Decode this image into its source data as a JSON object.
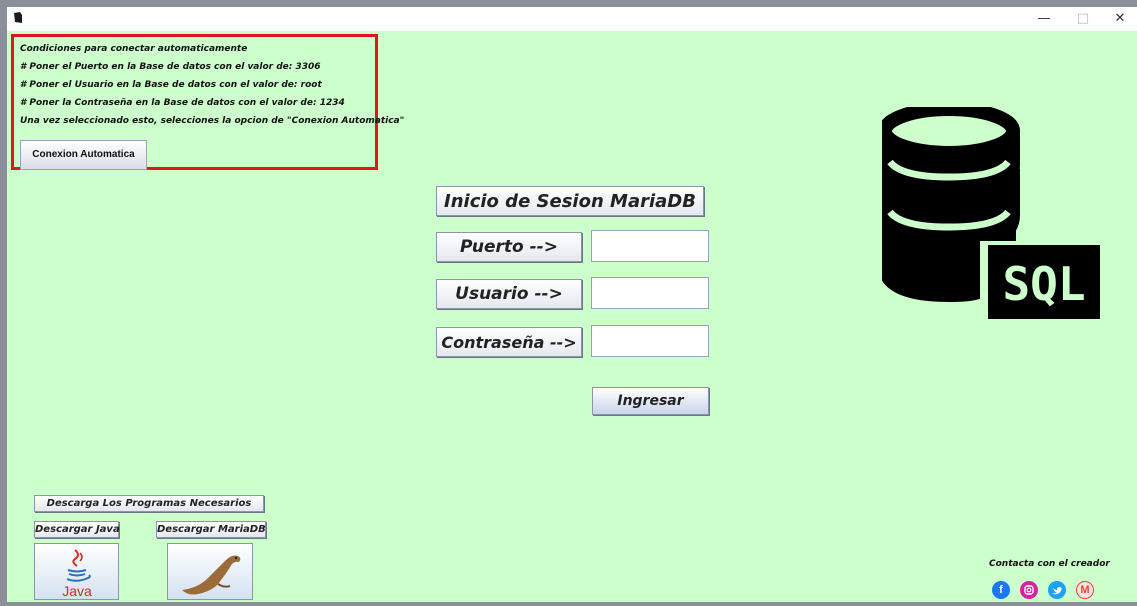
{
  "window": {
    "minimize_glyph": "—",
    "maximize_glyph": "□",
    "close_glyph": "✕"
  },
  "info": {
    "lines": [
      "Condiciones para conectar automaticamente",
      "# Poner el Puerto en la Base de datos con el valor de: 3306",
      "# Poner el Usuario en la Base de datos con el valor de: root",
      "# Poner la Contraseña en la Base de datos con el valor de: 1234",
      "Una vez seleccionado esto, selecciones la opcion de \"Conexion Automatica\""
    ],
    "auto_button": "Conexion Automatica",
    "border_color": "#e0161e"
  },
  "login": {
    "title": "Inicio de Sesion MariaDB",
    "port_label": "Puerto -->",
    "port_value": "",
    "user_label": "Usuario -->",
    "user_value": "",
    "password_label": "Contraseña -->",
    "password_value": "",
    "submit": "Ingresar"
  },
  "downloads": {
    "header": "Descarga Los Programas Necesarios",
    "java_label": "Descargar Java",
    "mariadb_label": "Descargar MariaDB",
    "java_logo_text": "Java"
  },
  "db_logo": {
    "text": "SQL"
  },
  "contact": {
    "label": "Contacta con el creador",
    "icons": [
      "facebook-icon",
      "instagram-icon",
      "twitter-icon",
      "gmail-icon"
    ]
  },
  "colors": {
    "background": "#ccffcc",
    "facebook": "#1877f2",
    "instagram": "#d6249f",
    "twitter": "#1da1f2",
    "gmail": "#ea4335"
  }
}
